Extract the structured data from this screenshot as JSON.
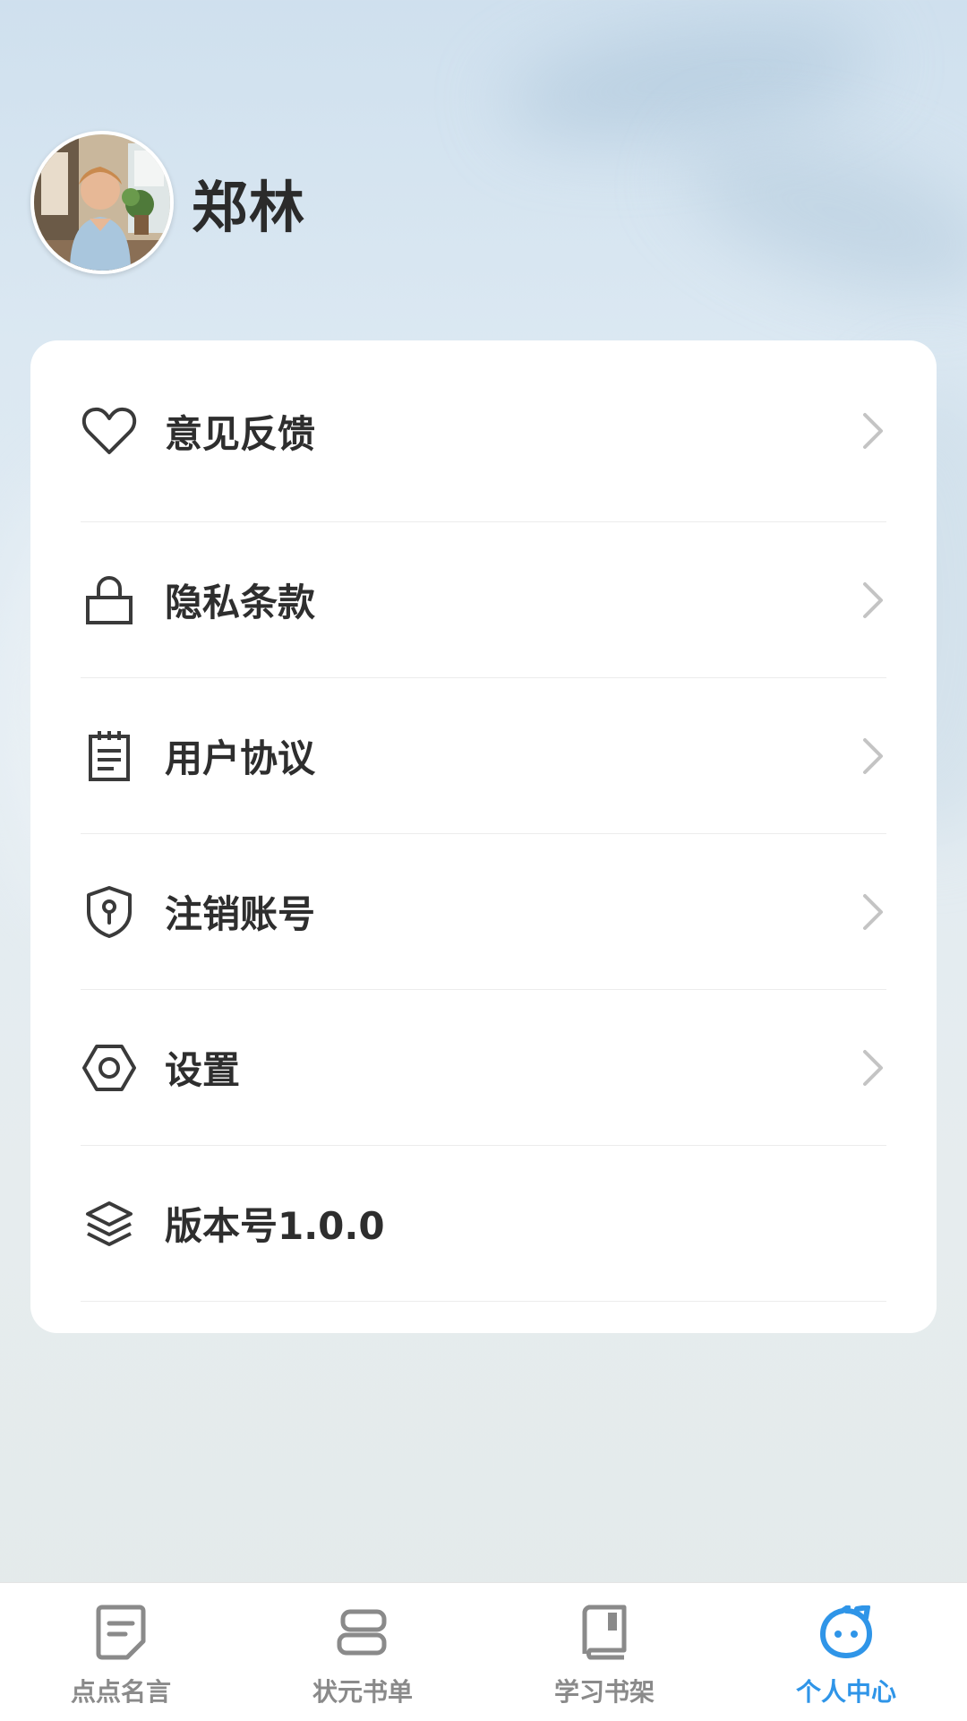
{
  "profile": {
    "name": "郑林"
  },
  "menu": {
    "items": [
      {
        "icon": "heart-icon",
        "label": "意见反馈",
        "has_arrow": true
      },
      {
        "icon": "lock-icon",
        "label": "隐私条款",
        "has_arrow": true
      },
      {
        "icon": "notepad-icon",
        "label": "用户协议",
        "has_arrow": true
      },
      {
        "icon": "shield-keyhole-icon",
        "label": "注销账号",
        "has_arrow": true
      },
      {
        "icon": "hexagon-nut-icon",
        "label": "设置",
        "has_arrow": true
      },
      {
        "icon": "layers-icon",
        "label": "版本号1.0.0",
        "has_arrow": false
      }
    ]
  },
  "tabbar": {
    "tabs": [
      {
        "icon": "document-icon",
        "label": "点点名言",
        "active": false
      },
      {
        "icon": "stack-icon",
        "label": "状元书单",
        "active": false
      },
      {
        "icon": "book-icon",
        "label": "学习书架",
        "active": false
      },
      {
        "icon": "smiley-face-icon",
        "label": "个人中心",
        "active": true
      }
    ]
  },
  "colors": {
    "accent": "#2f95e8",
    "text": "#2e2e2e",
    "inactive": "#8a8a8a"
  }
}
